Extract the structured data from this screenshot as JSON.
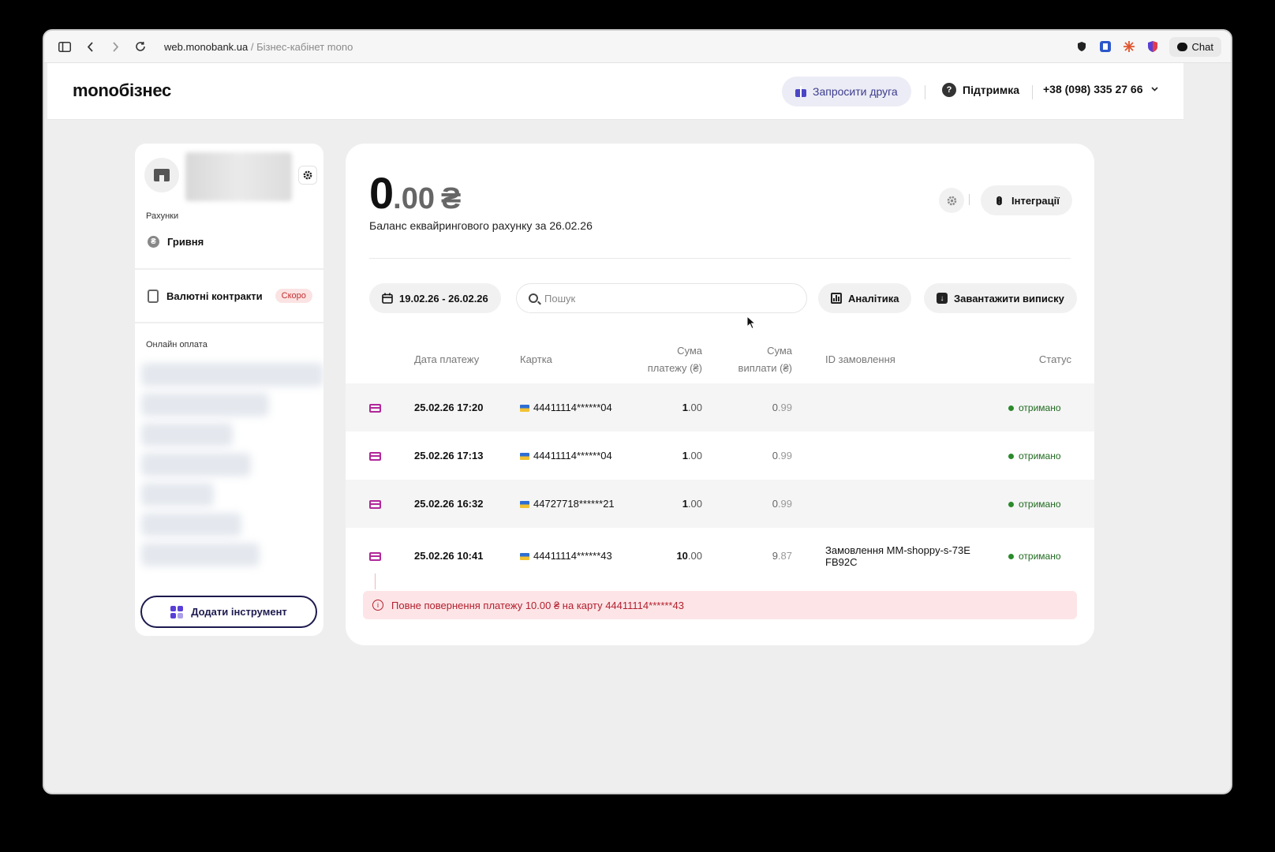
{
  "browser": {
    "url_host": "web.monobank.ua",
    "url_sep": " / ",
    "url_title": "Бізнес-кабінет mono",
    "chat_label": "Chat"
  },
  "header": {
    "logo": "monoбізнес",
    "invite_label": "Запросити друга",
    "support_label": "Підтримка",
    "phone": "+38 (098) 335 27 66"
  },
  "sidebar": {
    "accounts_label": "Рахунки",
    "account_name": "Гривня",
    "account_symbol": "₴",
    "contracts_label": "Валютні контракти",
    "soon_badge": "Скоро",
    "online_label": "Онлайн оплата",
    "add_tool_label": "Додати інструмент"
  },
  "main": {
    "balance_int": "0",
    "balance_frac": ".00",
    "balance_currency": "₴",
    "balance_caption": "Баланс еквайрингового рахунку за 26.02.26",
    "integrations_label": "Інтеграції",
    "date_range": "19.02.26 - 26.02.26",
    "search_placeholder": "Пошук",
    "analytics_label": "Аналітика",
    "download_label": "Завантажити виписку"
  },
  "table": {
    "headers": {
      "date": "Дата платежу",
      "card": "Картка",
      "amount_l1": "Сума",
      "amount_l2": "платежу (₴)",
      "payout_l1": "Сума",
      "payout_l2": "виплати (₴)",
      "order": "ID замовлення",
      "status": "Статус"
    },
    "rows": [
      {
        "date": "25.02.26 17:20",
        "card": "44411114******04",
        "amount_int": "1",
        "amount_frac": ".00",
        "payout_int": "0",
        "payout_frac": ".99",
        "order": "",
        "status": "отримано"
      },
      {
        "date": "25.02.26 17:13",
        "card": "44411114******04",
        "amount_int": "1",
        "amount_frac": ".00",
        "payout_int": "0",
        "payout_frac": ".99",
        "order": "",
        "status": "отримано"
      },
      {
        "date": "25.02.26 16:32",
        "card": "44727718******21",
        "amount_int": "1",
        "amount_frac": ".00",
        "payout_int": "0",
        "payout_frac": ".99",
        "order": "",
        "status": "отримано"
      },
      {
        "date": "25.02.26 10:41",
        "card": "44411114******43",
        "amount_int": "10",
        "amount_frac": ".00",
        "payout_int": "9",
        "payout_frac": ".87",
        "order_l1": "Замовлення MM-shoppy-s-73E",
        "order_l2": "FB92C",
        "status": "отримано"
      }
    ],
    "refund_notice": "Повне повернення платежу 10.00 ₴ на карту 44411114******43"
  },
  "colors": {
    "accent_purple": "#4a46c6",
    "card_icon": "#b1279a",
    "status_green": "#2b8a2b",
    "refund_bg": "#fde5e7",
    "refund_text": "#b3202e"
  }
}
